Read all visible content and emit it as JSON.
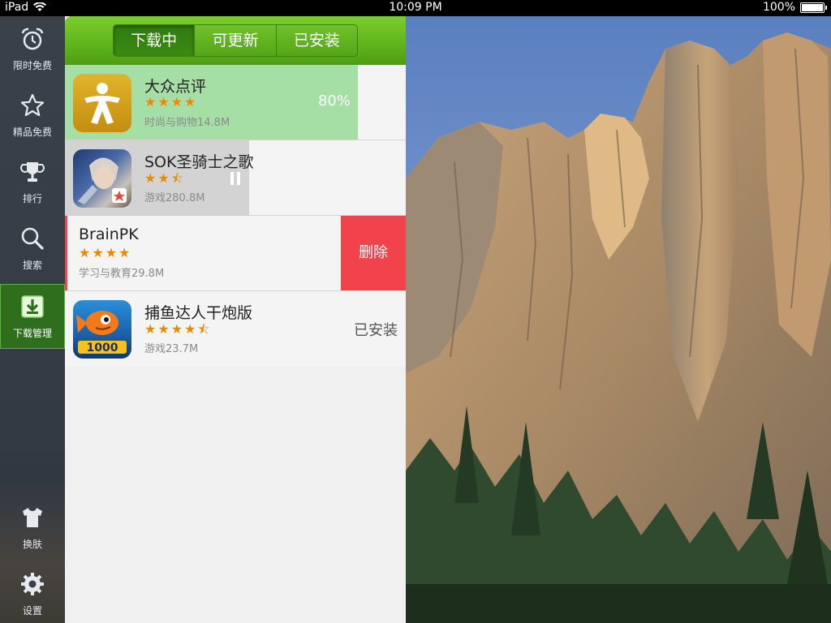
{
  "status_bar": {
    "device": "iPad",
    "time": "10:09 PM",
    "battery": "100%",
    "battery_level": 1.0
  },
  "sidebar": {
    "items": [
      {
        "label": "限时免费",
        "icon": "alarm-clock-icon"
      },
      {
        "label": "精品免费",
        "icon": "star-icon"
      },
      {
        "label": "排行",
        "icon": "trophy-icon"
      },
      {
        "label": "搜索",
        "icon": "search-icon"
      },
      {
        "label": "下载管理",
        "icon": "download-icon",
        "active": true
      },
      {
        "label": "换肤",
        "icon": "tshirt-icon"
      },
      {
        "label": "设置",
        "icon": "gear-icon"
      }
    ]
  },
  "tabs": [
    {
      "label": "下载中",
      "selected": true
    },
    {
      "label": "可更新",
      "selected": false
    },
    {
      "label": "已安装",
      "selected": false
    }
  ],
  "downloads": [
    {
      "name": "大众点评",
      "stars": "★★★★",
      "meta": "时尚与购物14.8M",
      "status": "80%",
      "progress": 0.86
    },
    {
      "name": "SOK圣骑士之歌",
      "stars": "★★⯪",
      "meta": "游戏280.8M",
      "status": "paused",
      "progress": 0.54
    },
    {
      "name": "BrainPK",
      "stars": "★★★★",
      "meta": "学习与教育29.8M",
      "action": "删除"
    },
    {
      "name": "捕鱼达人干炮版",
      "stars": "★★★★⯪",
      "meta": "游戏23.7M",
      "status": "已安装"
    }
  ],
  "colors": {
    "accent_green": "#5fb41c",
    "progress_green": "#a6dfa6",
    "progress_gray": "#d3d3d3",
    "delete_red": "#f2434d",
    "star_orange": "#e8890c"
  }
}
